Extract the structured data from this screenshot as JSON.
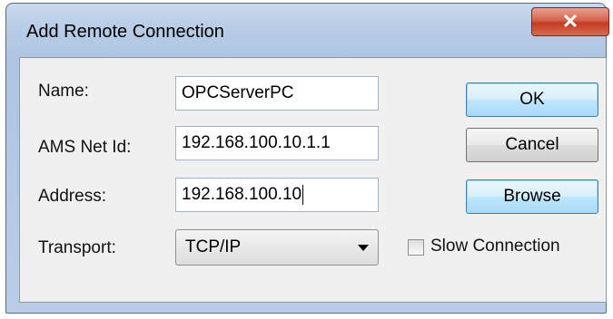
{
  "dialog": {
    "title": "Add Remote Connection",
    "close_icon": "close-icon"
  },
  "form": {
    "name_label": "Name:",
    "name_value": "OPCServerPC",
    "ams_label": "AMS Net Id:",
    "ams_value": "192.168.100.10.1.1",
    "address_label": "Address:",
    "address_value": "192.168.100.10",
    "transport_label": "Transport:",
    "transport_value": "TCP/IP"
  },
  "buttons": {
    "ok": "OK",
    "cancel": "Cancel",
    "browse": "Browse"
  },
  "options": {
    "slow_connection_label": "Slow Connection",
    "slow_connection_checked": false
  },
  "colors": {
    "close_button": "#c94a32",
    "focus_button_border": "#3c7fb1"
  }
}
